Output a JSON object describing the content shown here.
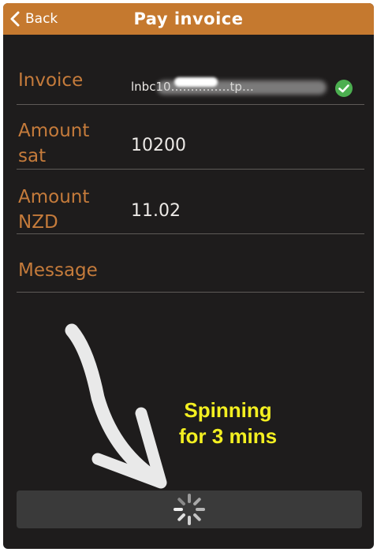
{
  "header": {
    "back_label": "Back",
    "title": "Pay invoice",
    "background_color": "#c5792f"
  },
  "form": {
    "invoice": {
      "label": "Invoice",
      "value": "lnbc10……………tp…",
      "valid_icon": "check-circle-icon"
    },
    "amount_sat": {
      "label_line1": "Amount",
      "label_line2": "sat",
      "value": "10200"
    },
    "amount_nzd": {
      "label_line1": "Amount",
      "label_line2": "NZD",
      "value": "11.02"
    },
    "message": {
      "label": "Message",
      "value": ""
    }
  },
  "annotation": {
    "line1": "Spinning",
    "line2": "for 3 mins",
    "color": "#f3ef21"
  },
  "pay_button": {
    "state": "loading",
    "icon": "spinner-icon"
  },
  "colors": {
    "background": "#1e1c1c",
    "label": "#c57b3b",
    "value_text": "#ece9e6",
    "divider": "#5e5a57",
    "valid_green": "#4caf50"
  }
}
